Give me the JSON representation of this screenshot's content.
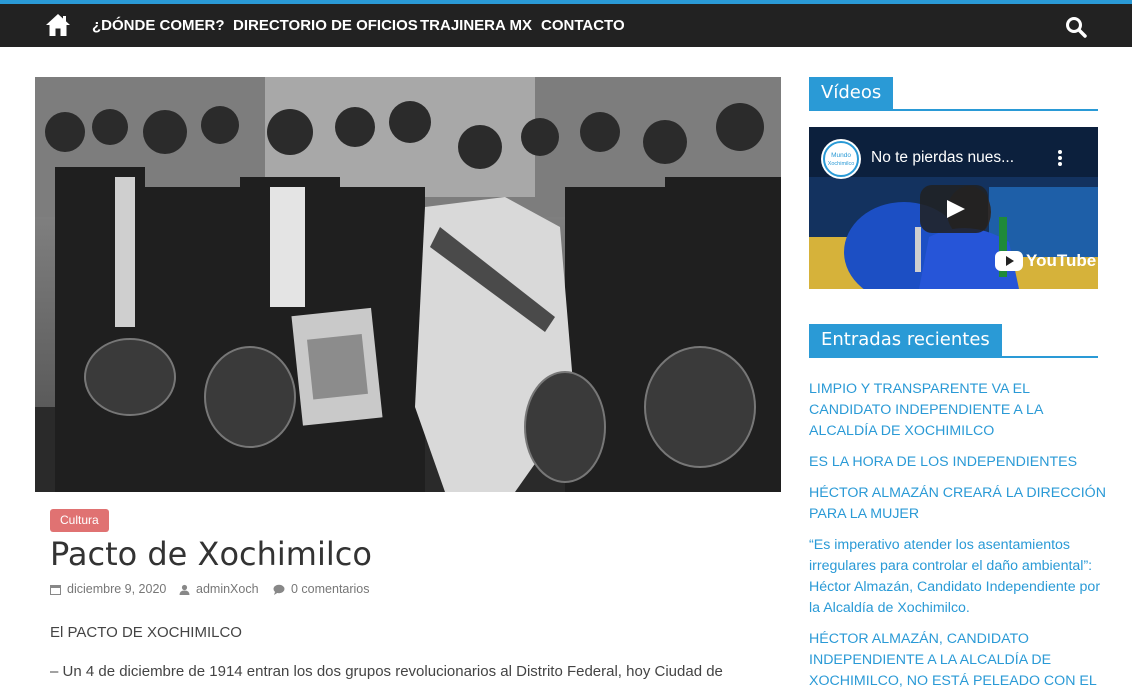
{
  "nav": {
    "items": [
      {
        "label": "¿DÓNDE COMER?"
      },
      {
        "label": "DIRECTORIO DE OFICIOS"
      },
      {
        "label": "TRAJINERA MX"
      },
      {
        "label": "CONTACTO"
      }
    ],
    "icons": [
      "home-icon",
      "search-icon"
    ]
  },
  "post": {
    "category": "Cultura",
    "title": "Pacto de Xochimilco",
    "date": "diciembre 9, 2020",
    "author": "adminXoch",
    "comments": "0 comentarios",
    "paragraphs": [
      "El PACTO DE XOCHIMILCO",
      "– Un 4 de diciembre de 1914 entran los dos grupos revolucionarios al Distrito Federal, hoy Ciudad de"
    ]
  },
  "sidebar": {
    "videos_title": "Vídeos",
    "video": {
      "title": "No te pierdas nues...",
      "logo_text": "Mundo Xochimilco",
      "platform": "YouTube"
    },
    "recent_title": "Entradas recientes",
    "recent": [
      {
        "text": "LIMPIO Y TRANSPARENTE VA EL CANDIDATO INDEPENDIENTE A LA ALCALDÍA DE XOCHIMILCO"
      },
      {
        "text": "ES LA HORA DE LOS INDEPENDIENTES"
      },
      {
        "text": "HÉCTOR ALMAZÁN CREARÁ LA DIRECCIÓN PARA LA MUJER"
      },
      {
        "text": "“Es imperativo atender los asentamientos irregulares para controlar el daño ambiental”: Héctor Almazán, Candidato Independiente por la Alcaldía de Xochimilco."
      },
      {
        "text": "HÉCTOR ALMAZÁN, CANDIDATO INDEPENDIENTE A LA ALCALDÍA DE XOCHIMILCO, NO ESTÁ PELEADO CON EL"
      }
    ]
  },
  "colors": {
    "accent": "#2a9ad6",
    "navbar": "#222222",
    "badge": "#e07272"
  }
}
